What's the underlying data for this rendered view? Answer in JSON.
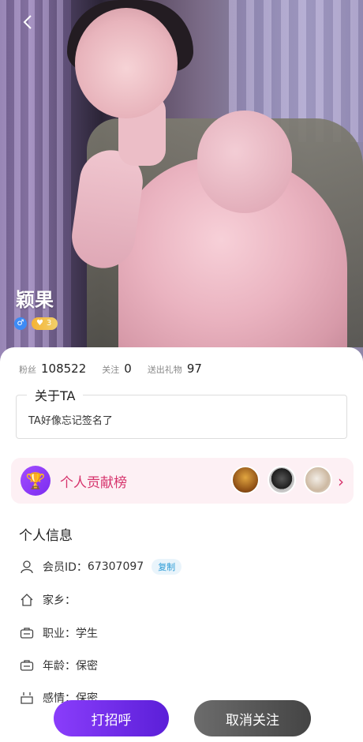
{
  "profile": {
    "nickname": "颖果",
    "level": "3"
  },
  "stats": [
    {
      "label": "粉丝",
      "value": "108522"
    },
    {
      "label": "关注",
      "value": "0"
    },
    {
      "label": "送出礼物",
      "value": "97"
    }
  ],
  "about": {
    "title": "关于TA",
    "text": "TA好像忘记签名了"
  },
  "contribution": {
    "label": "个人贡献榜"
  },
  "info": {
    "title": "个人信息",
    "member_id_label": "会员ID：",
    "member_id": "67307097",
    "copy_label": "复制",
    "hometown": "家乡：",
    "occupation": "职业：学生",
    "age": "年龄：保密",
    "relationship": "感情：保密"
  },
  "actions": {
    "greet": "打招呼",
    "unfollow": "取消关注"
  }
}
